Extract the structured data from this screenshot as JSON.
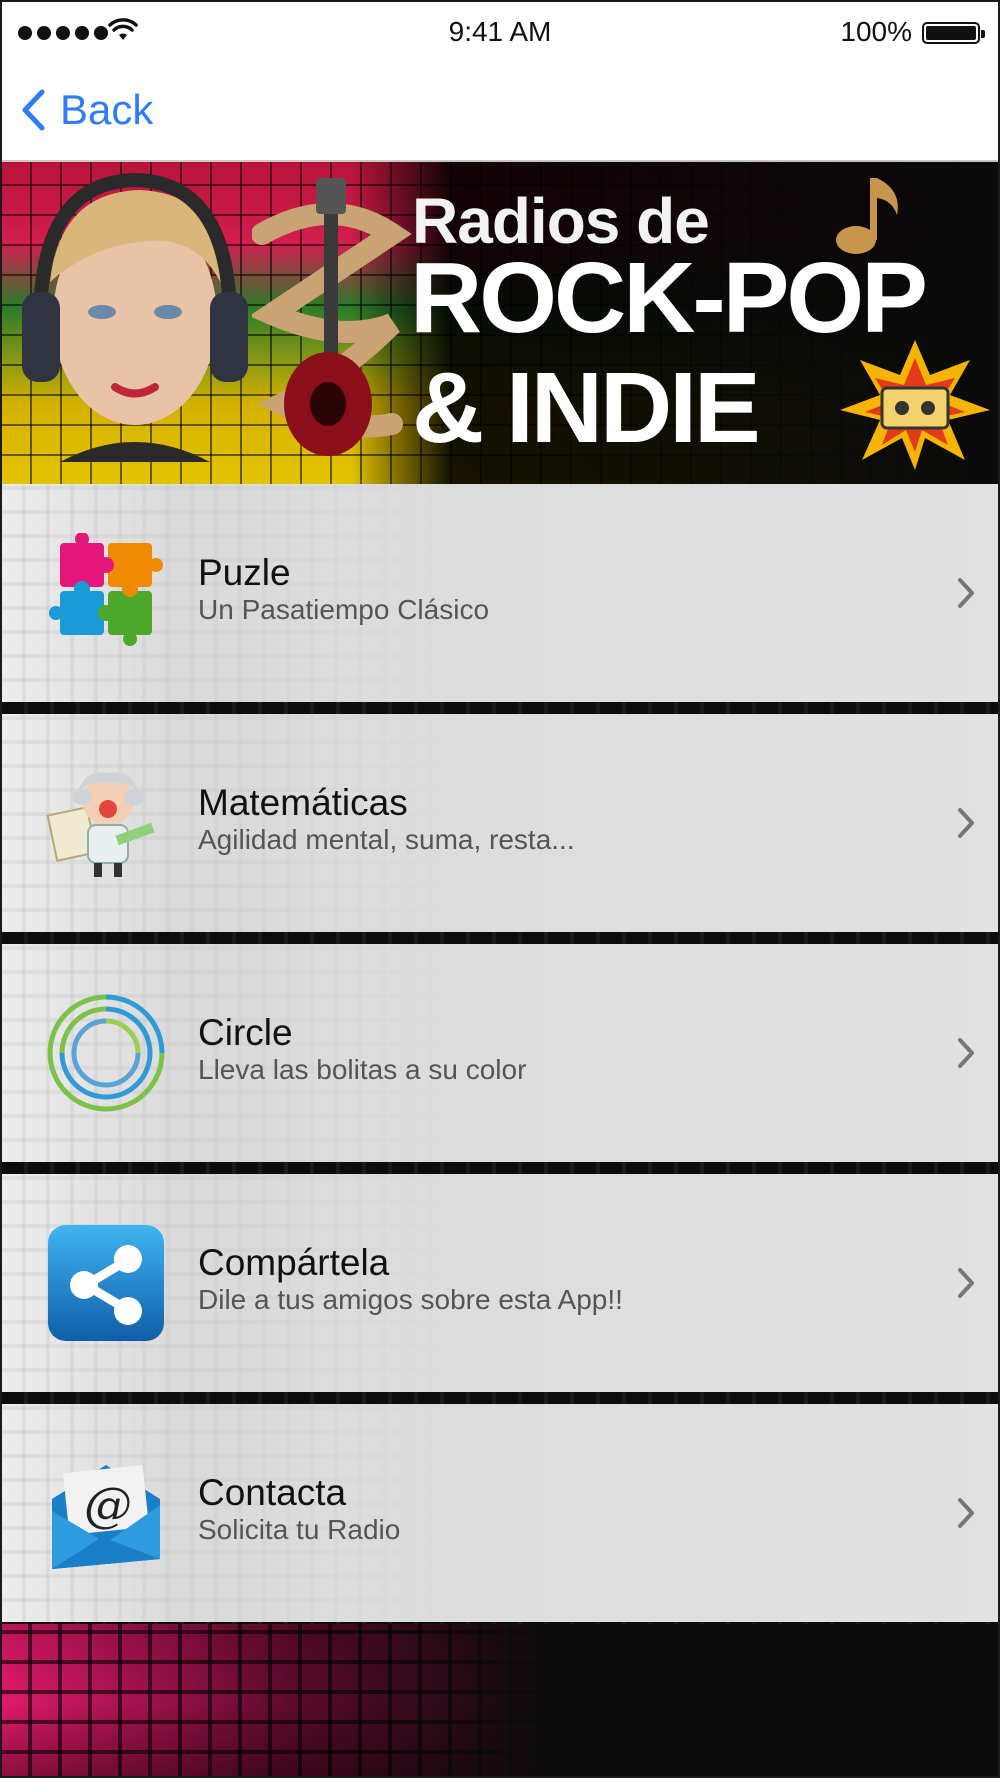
{
  "status_bar": {
    "time": "9:41 AM",
    "battery": "100%"
  },
  "nav": {
    "back_label": "Back",
    "accent_color": "#2f7cf6"
  },
  "banner": {
    "line1": "Radios de",
    "line2": "ROCK-POP",
    "line3": "& INDIE"
  },
  "menu": {
    "items": [
      {
        "title": "Puzle",
        "subtitle": "Un Pasatiempo Clásico",
        "icon": "puzzle-icon"
      },
      {
        "title": "Matemáticas",
        "subtitle": "Agilidad mental, suma, resta...",
        "icon": "professor-icon"
      },
      {
        "title": "Circle",
        "subtitle": "Lleva las bolitas a su color",
        "icon": "circle-rings-icon"
      },
      {
        "title": "Compártela",
        "subtitle": "Dile a tus amigos sobre esta App!!",
        "icon": "share-icon"
      },
      {
        "title": "Contacta",
        "subtitle": "Solicita tu Radio",
        "icon": "email-envelope-icon"
      }
    ]
  }
}
